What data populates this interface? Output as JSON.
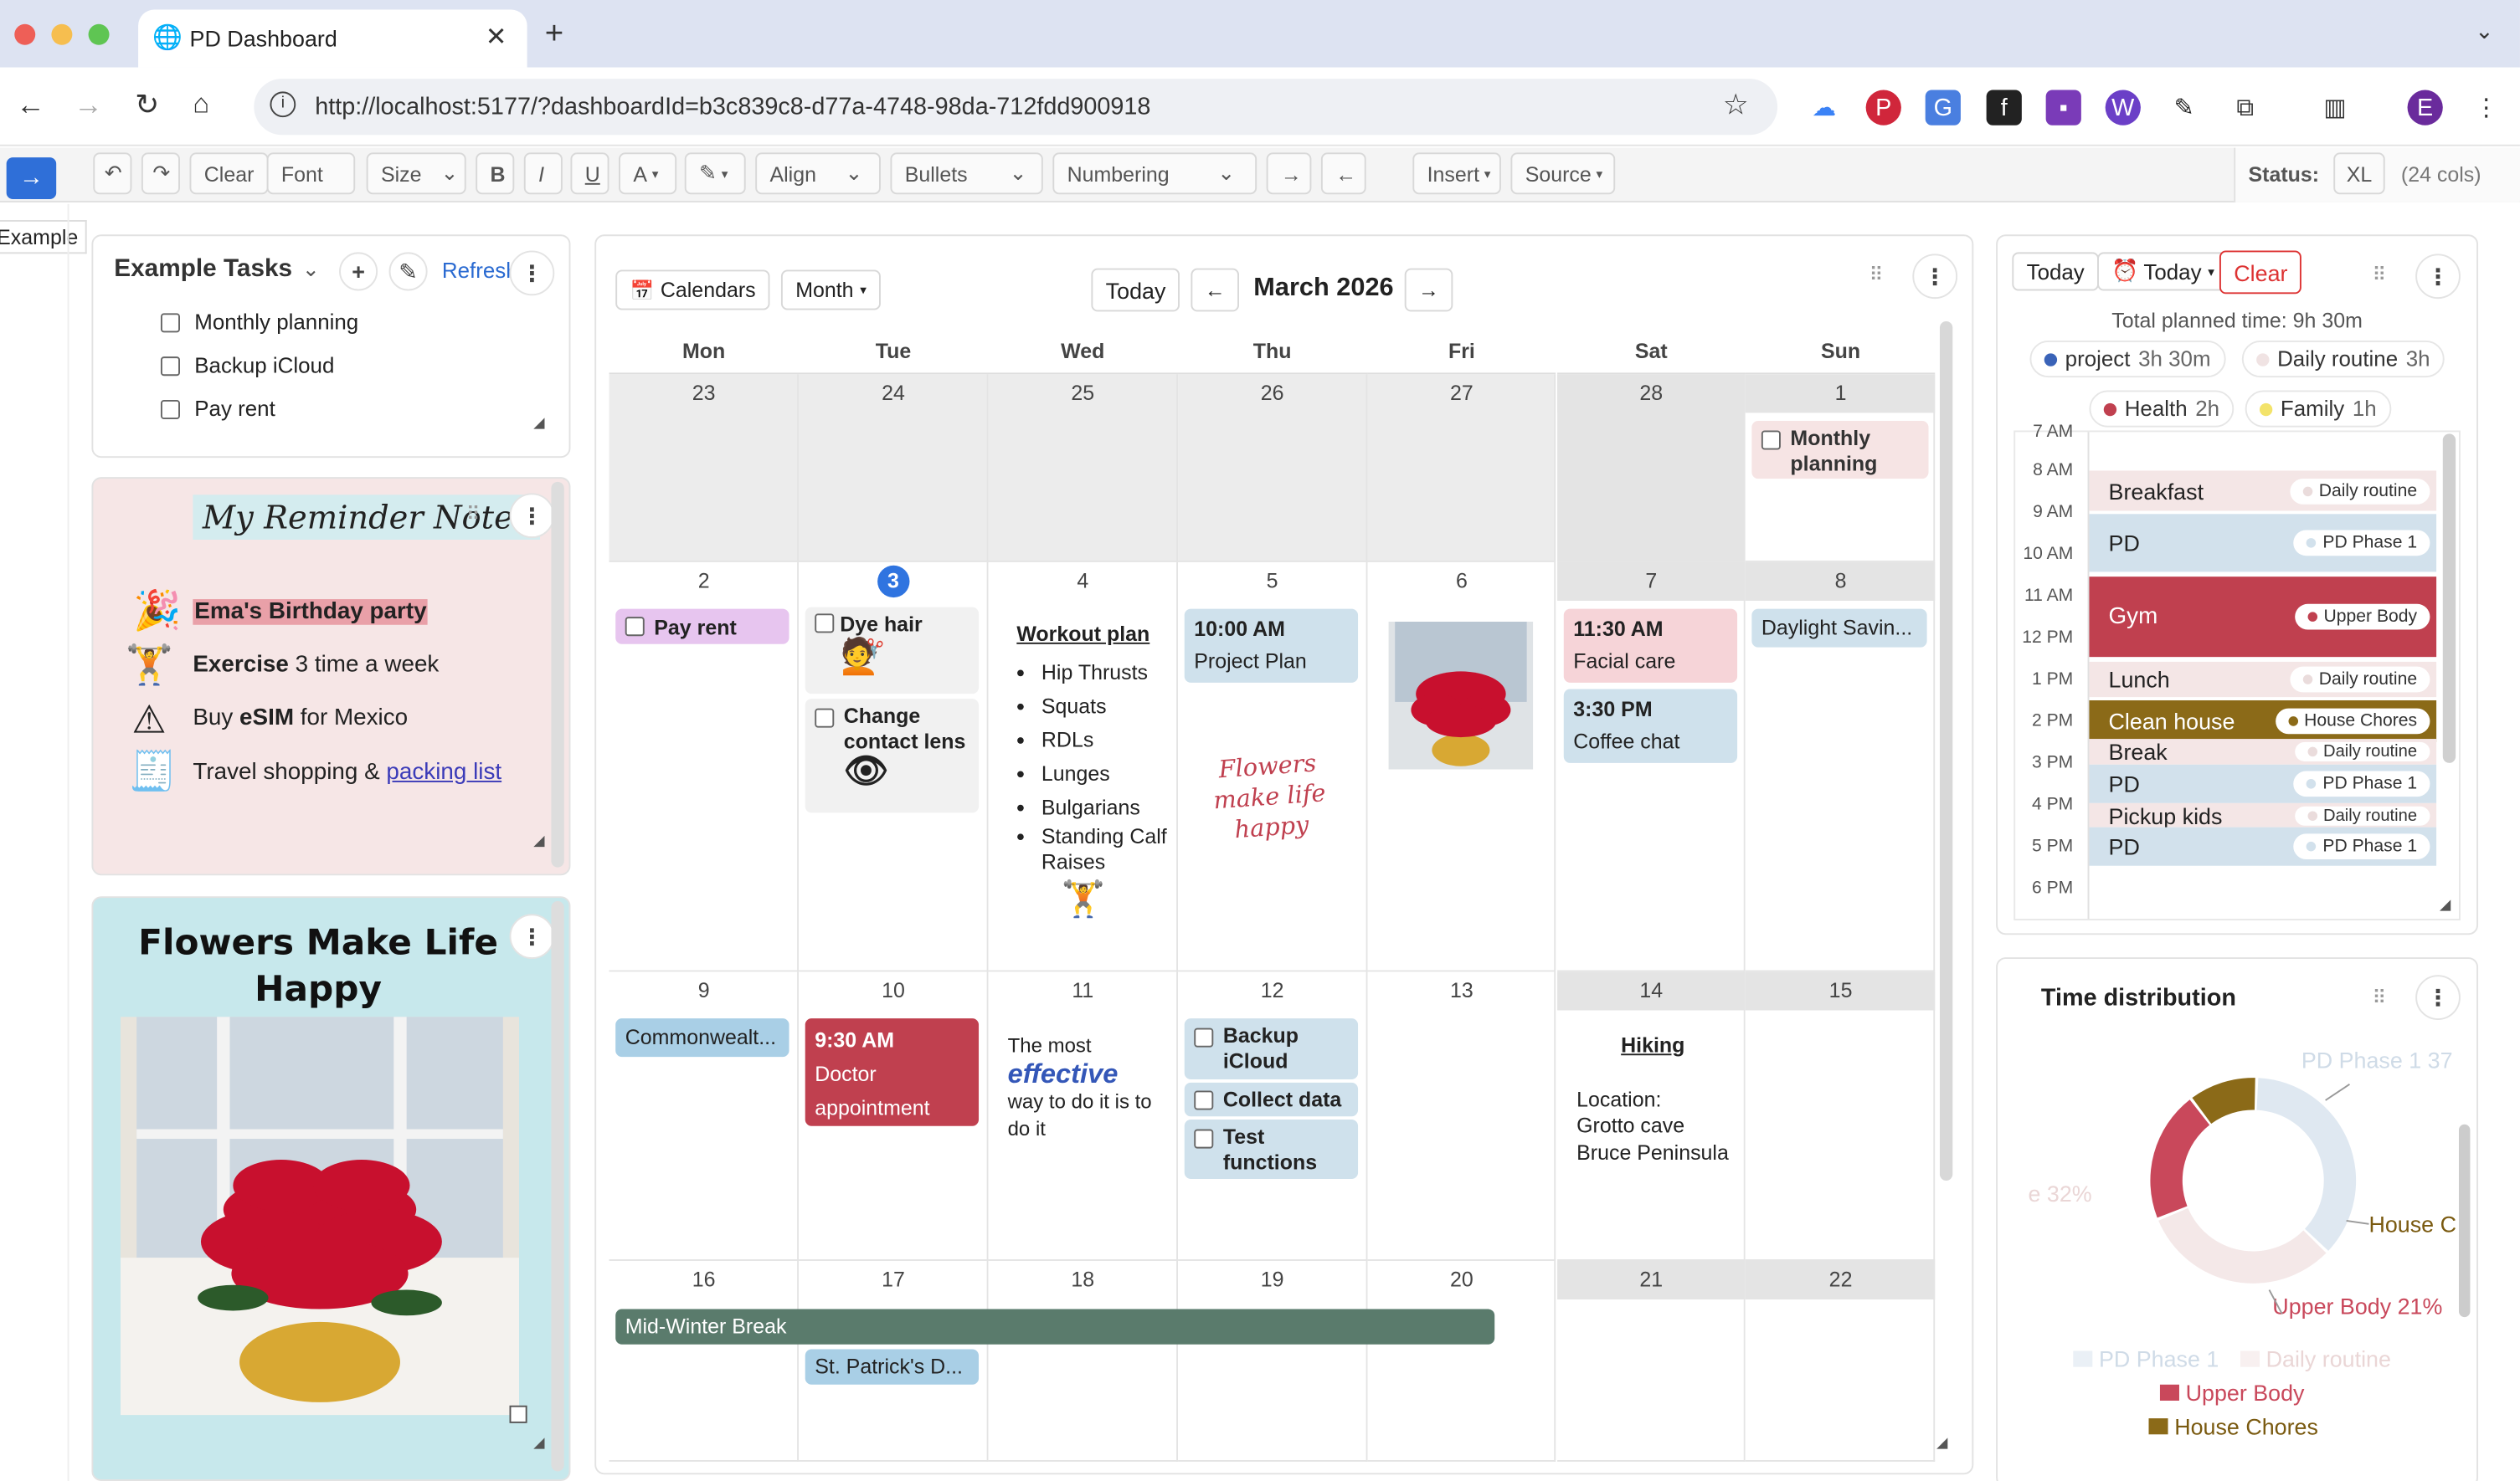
{
  "browser": {
    "tab_title": "PD Dashboard",
    "url": "http://localhost:5177/?dashboardId=b3c839c8-d77a-4748-98da-712fdd900918",
    "profile": "E"
  },
  "toolbar": {
    "clear": "Clear",
    "font": "Font",
    "size": "Size",
    "bold": "B",
    "italic": "I",
    "underline": "U",
    "font_color": "A",
    "align": "Align",
    "bullets": "Bullets",
    "numbering": "Numbering",
    "insert": "Insert",
    "source": "Source",
    "status_label": "Status:",
    "status_value": "XL",
    "cols": "(24 cols)"
  },
  "sidebar": {
    "tab_label": "Example"
  },
  "tasks": {
    "title": "Example Tasks",
    "refresh": "Refresh",
    "items": [
      "Monthly planning",
      "Backup iCloud",
      "Pay rent"
    ]
  },
  "notes": {
    "title": "My Reminder Notes",
    "line1": "Ema's Birthday party",
    "line2_bold": "Exercise",
    "line2_rest": " 3 time a week",
    "line3_pre": "Buy ",
    "line3_bold": "eSIM",
    "line3_post": " for Mexico",
    "line4_pre": "Travel shopping & ",
    "line4_link": "packing list"
  },
  "flowers": {
    "title_line1": "Flowers Make Life",
    "title_line2": "Happy"
  },
  "calendar": {
    "calendars_btn": "Calendars",
    "view_btn": "Month",
    "today_btn": "Today",
    "month_title": "March 2026",
    "weekdays": [
      "Mon",
      "Tue",
      "Wed",
      "Thu",
      "Fri",
      "Sat",
      "Sun"
    ],
    "weeks": [
      [
        "23",
        "24",
        "25",
        "26",
        "27",
        "28",
        "1"
      ],
      [
        "2",
        "3",
        "4",
        "5",
        "6",
        "7",
        "8"
      ],
      [
        "9",
        "10",
        "11",
        "12",
        "13",
        "14",
        "15"
      ],
      [
        "16",
        "17",
        "18",
        "19",
        "20",
        "21",
        "22"
      ]
    ],
    "events": {
      "monthly_planning": "Monthly planning",
      "pay_rent": "Pay rent",
      "dye_hair": "Dye hair",
      "change_lens": "Change contact lens",
      "workout_title": "Workout plan",
      "workout_items": [
        "Hip Thrusts",
        "Squats",
        "RDLs",
        "Lunges",
        "Bulgarians",
        "Standing Calf Raises"
      ],
      "project_time": "10:00 AM",
      "project_name": "Project Plan",
      "flowers_script": "Flowers make life happy",
      "facial_time": "11:30 AM",
      "facial_name": "Facial care",
      "coffee_time": "3:30 PM",
      "coffee_name": "Coffee chat",
      "daylight": "Daylight Savin...",
      "commonwealth": "Commonwealt...",
      "doctor_time": "9:30 AM",
      "doctor_name": "Doctor appointment",
      "effective_pre": "The most",
      "effective_word": "effective",
      "effective_post": "way to do it is to do it",
      "backup": "Backup iCloud",
      "collect": "Collect data",
      "test": "Test functions",
      "hiking_title": "Hiking",
      "hiking_loc": "Location:",
      "hiking_place": "Grotto cave Bruce Peninsula",
      "midwinter": "Mid-Winter Break",
      "stpatrick": "St. Patrick's D..."
    }
  },
  "planner": {
    "today_btn": "Today",
    "today_select": "Today",
    "clear_btn": "Clear",
    "total": "Total planned time: 9h 30m",
    "chips": [
      {
        "name": "project",
        "time": "3h 30m",
        "color": "#3a63b8"
      },
      {
        "name": "Daily routine",
        "time": "3h",
        "color": "#f0e3e3"
      },
      {
        "name": "Health",
        "time": "2h",
        "color": "#c0404f"
      },
      {
        "name": "Family",
        "time": "1h",
        "color": "#f3e36a"
      }
    ],
    "hours": [
      "7 AM",
      "8 AM",
      "9 AM",
      "10 AM",
      "11 AM",
      "12 PM",
      "1 PM",
      "2 PM",
      "3 PM",
      "4 PM",
      "5 PM",
      "6 PM"
    ],
    "blocks": [
      {
        "name": "Breakfast",
        "tag": "Daily routine"
      },
      {
        "name": "PD",
        "tag": "PD Phase 1"
      },
      {
        "name": "Gym",
        "tag": "Upper Body"
      },
      {
        "name": "Lunch",
        "tag": "Daily routine"
      },
      {
        "name": "Clean house",
        "tag": "House Chores"
      },
      {
        "name": "Break",
        "tag": "Daily routine"
      },
      {
        "name": "PD",
        "tag": "PD Phase 1"
      },
      {
        "name": "Pickup kids",
        "tag": "Daily routine"
      },
      {
        "name": "PD",
        "tag": "PD Phase 1"
      }
    ]
  },
  "distribution": {
    "title": "Time distribution",
    "chart_data": {
      "type": "pie",
      "title": "Time distribution",
      "categories": [
        "PD Phase 1",
        "Daily routine",
        "Upper Body",
        "House Chores"
      ],
      "values": [
        37,
        32,
        21,
        11
      ],
      "colors": [
        "#dce6f0",
        "#f3e6e6",
        "#c9485b",
        "#8b6a18"
      ],
      "labels": [
        "PD Phase 1 37",
        "e 32%",
        "Upper Body 21%",
        "House C"
      ],
      "legend": [
        "PD Phase 1",
        "Daily routine",
        "Upper Body",
        "House Chores"
      ]
    }
  }
}
